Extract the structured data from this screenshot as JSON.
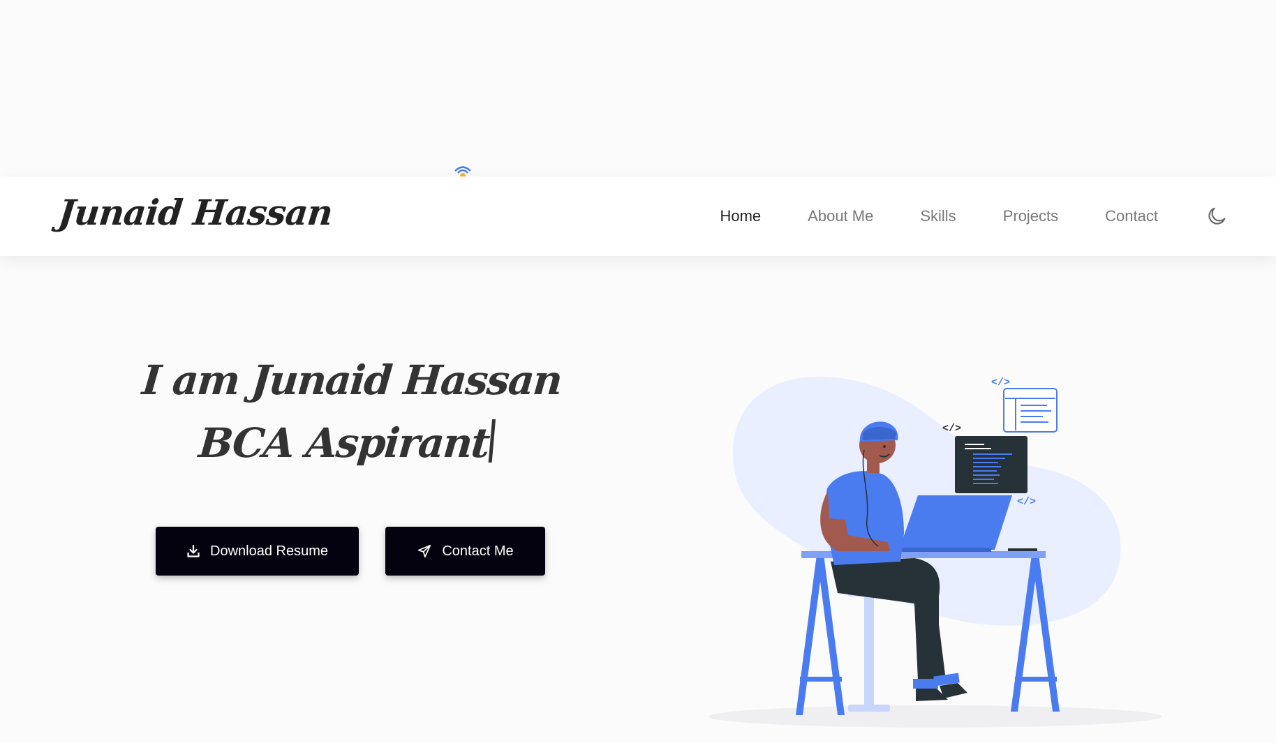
{
  "brand": {
    "name": "Junaid Hassan"
  },
  "nav": {
    "items": [
      {
        "label": "Home",
        "active": true
      },
      {
        "label": "About Me",
        "active": false
      },
      {
        "label": "Skills",
        "active": false
      },
      {
        "label": "Projects",
        "active": false
      },
      {
        "label": "Contact",
        "active": false
      }
    ],
    "theme_toggle_icon": "moon-icon"
  },
  "hero": {
    "line1": "I am Junaid Hassan",
    "line2": "BCA Aspirant",
    "buttons": {
      "resume": {
        "label": "Download Resume",
        "icon": "download-icon"
      },
      "contact": {
        "label": "Contact Me",
        "icon": "send-icon"
      }
    },
    "illustration_icon": "developer-at-desk-illustration"
  },
  "colors": {
    "background": "#fbfbfc",
    "navbar": "#ffffff",
    "button": "#04020f",
    "accent_blue": "#4a7cf0",
    "blob": "#e9efff",
    "text_dark": "#333333",
    "nav_muted": "#777777"
  }
}
